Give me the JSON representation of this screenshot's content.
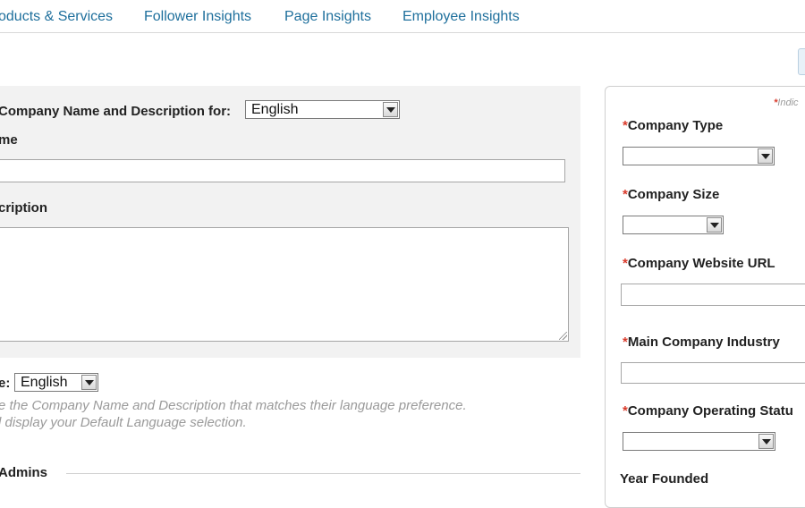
{
  "nav": {
    "tabs": [
      "oducts & Services",
      "Follower Insights",
      "Page Insights",
      "Employee Insights"
    ]
  },
  "main": {
    "desc_for_label": "Company Name and Description for:",
    "desc_language": "English",
    "name_label": "me",
    "description_label": "cription",
    "default_lang_label": "e:",
    "default_language": "English",
    "hint_line1": "e the Company Name and Description that matches their language preference.",
    "hint_line2": "l display your Default Language selection.",
    "admins_label": "Admins"
  },
  "sidebar": {
    "required_note": "Indic",
    "required_mark": "*",
    "fields": {
      "company_type": "Company Type",
      "company_size": "Company Size",
      "website_url": "Company Website URL",
      "main_industry": "Main Company Industry",
      "operating_status": "Company Operating Statu",
      "year_founded": "Year Founded"
    }
  }
}
